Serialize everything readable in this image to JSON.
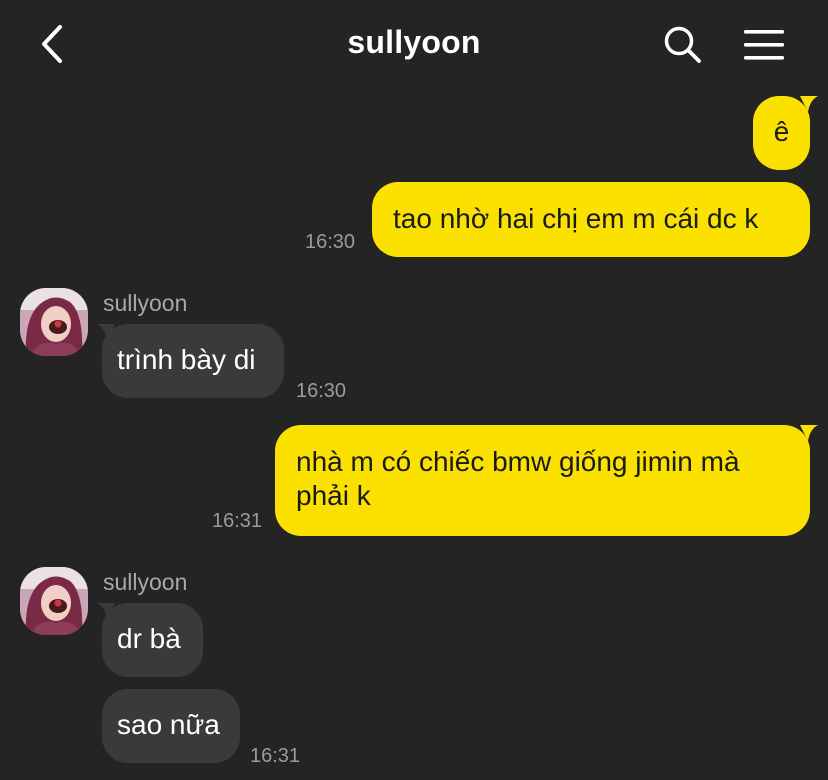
{
  "header": {
    "title": "sullyoon"
  },
  "icons": {
    "back": "chevron-left-icon",
    "search": "search-icon",
    "menu": "hamburger-menu-icon"
  },
  "colors": {
    "background": "#242424",
    "my_bubble": "#fae100",
    "their_bubble": "#3a3a3c",
    "timestamp": "#9b9b9b"
  },
  "messages": [
    {
      "from": "me",
      "text": "ê",
      "time": ""
    },
    {
      "from": "me",
      "text": "tao nhờ hai chị em m cái dc k",
      "time": "16:30"
    },
    {
      "from": "them",
      "sender": "sullyoon",
      "text": "trình bày di",
      "time": "16:30"
    },
    {
      "from": "me",
      "text": "nhà m có chiếc bmw giống jimin mà phải k",
      "time": "16:31"
    },
    {
      "from": "them",
      "sender": "sullyoon",
      "text": "dr bà",
      "time": ""
    },
    {
      "from": "them",
      "text": "sao nữa",
      "time": "16:31"
    }
  ]
}
